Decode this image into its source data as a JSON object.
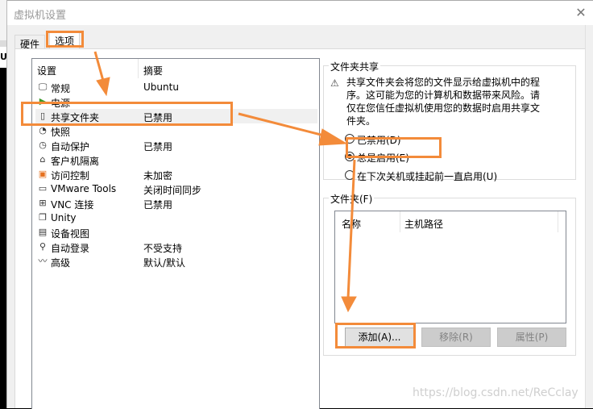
{
  "window": {
    "title": "虚拟机设置",
    "close_icon": "close-icon"
  },
  "tabs": [
    {
      "label": "硬件",
      "active": false
    },
    {
      "label": "选项",
      "active": true
    }
  ],
  "settings_list": {
    "columns": [
      "设置",
      "摘要"
    ],
    "items": [
      {
        "icon": "monitor-icon",
        "label": "常规",
        "summary": "Ubuntu"
      },
      {
        "icon": "power-icon",
        "label": "电源",
        "summary": ""
      },
      {
        "icon": "shared-folder-icon",
        "label": "共享文件夹",
        "summary": "已禁用",
        "selected": true
      },
      {
        "icon": "snapshot-icon",
        "label": "快照",
        "summary": ""
      },
      {
        "icon": "autoprotect-icon",
        "label": "自动保护",
        "summary": "已禁用"
      },
      {
        "icon": "lock-icon",
        "label": "客户机隔离",
        "summary": ""
      },
      {
        "icon": "access-control-icon",
        "label": "访问控制",
        "summary": "未加密"
      },
      {
        "icon": "vm-icon",
        "label": "VMware Tools",
        "summary": "关闭时间同步"
      },
      {
        "icon": "vnc-icon",
        "label": "VNC 连接",
        "summary": "已禁用"
      },
      {
        "icon": "unity-icon",
        "label": "Unity",
        "summary": ""
      },
      {
        "icon": "device-view-icon",
        "label": "设备视图",
        "summary": ""
      },
      {
        "icon": "autologin-icon",
        "label": "自动登录",
        "summary": "不受支持"
      },
      {
        "icon": "advanced-icon",
        "label": "高级",
        "summary": "默认/默认"
      }
    ]
  },
  "folder_sharing": {
    "title": "文件夹共享",
    "warning": "共享文件夹会将您的文件显示给虚拟机中的程序。这可能为您的计算机和数据带来风险。请仅在您信任虚拟机使用您的数据时启用共享文件夹。",
    "options": [
      {
        "label": "已禁用(D)",
        "checked": false
      },
      {
        "label": "总是启用(E)",
        "checked": true
      },
      {
        "label": "在下次关机或挂起前一直启用(U)",
        "checked": false
      }
    ]
  },
  "folders": {
    "title": "文件夹(F)",
    "columns": [
      "名称",
      "主机路径"
    ],
    "rows": [],
    "buttons": {
      "add": "添加(A)...",
      "remove": "移除(R)",
      "properties": "属性(P)"
    }
  },
  "annotation": {
    "color": "#f38b3a"
  },
  "watermark": "https://blog.csdn.net/ReCclay"
}
